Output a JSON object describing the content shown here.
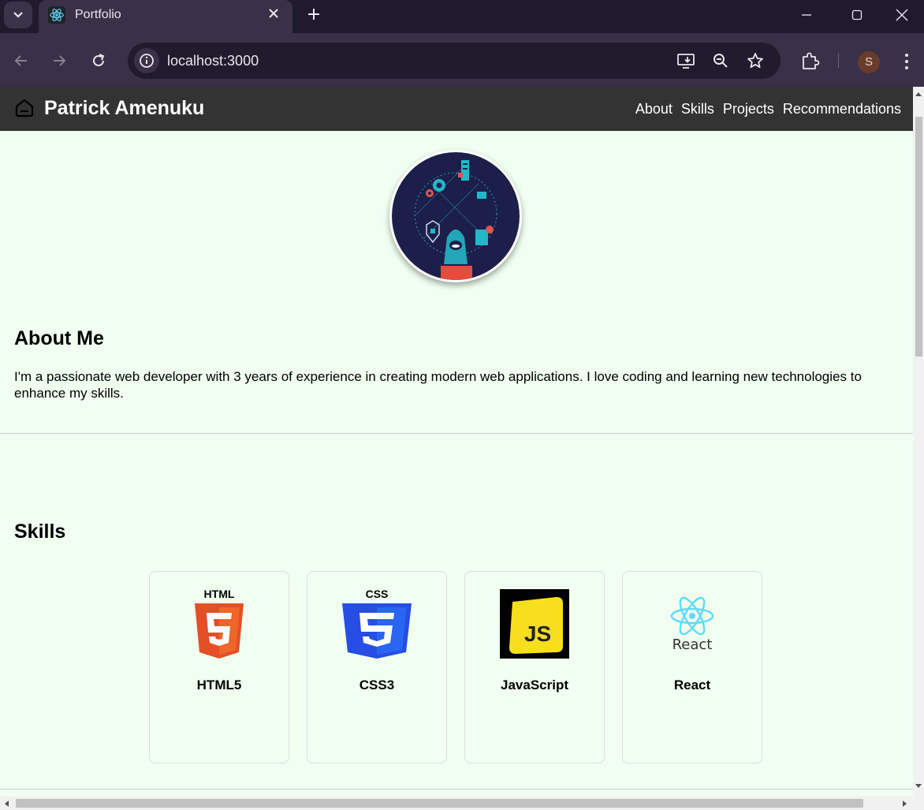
{
  "browser": {
    "tab_title": "Portfolio",
    "url": "localhost:3000",
    "profile_initial": "S",
    "icons": {
      "tab_menu": "chevron-down-icon",
      "favicon": "react-icon",
      "close": "close-icon",
      "new_tab": "plus-icon",
      "back": "arrow-left-icon",
      "forward": "arrow-right-icon",
      "reload": "reload-icon",
      "site_info": "info-icon",
      "install": "install-app-icon",
      "zoom": "zoom-icon",
      "bookmark": "star-icon",
      "extensions": "puzzle-icon",
      "menu": "kebab-menu-icon"
    }
  },
  "site": {
    "name": "Patrick Amenuku",
    "nav": [
      "About",
      "Skills",
      "Projects",
      "Recommendations"
    ],
    "colors": {
      "header_bg": "#333333",
      "page_bg": "#f0fff0"
    }
  },
  "about": {
    "heading": "About Me",
    "text": "I'm a passionate web developer with 3 years of experience in creating modern web applications. I love coding and learning new technologies to enhance my skills."
  },
  "skills": {
    "heading": "Skills",
    "items": [
      {
        "name": "HTML5",
        "logo": "html5-logo"
      },
      {
        "name": "CSS3",
        "logo": "css3-logo"
      },
      {
        "name": "JavaScript",
        "logo": "javascript-logo"
      },
      {
        "name": "React",
        "logo": "react-logo",
        "logo_text": "React"
      }
    ]
  }
}
